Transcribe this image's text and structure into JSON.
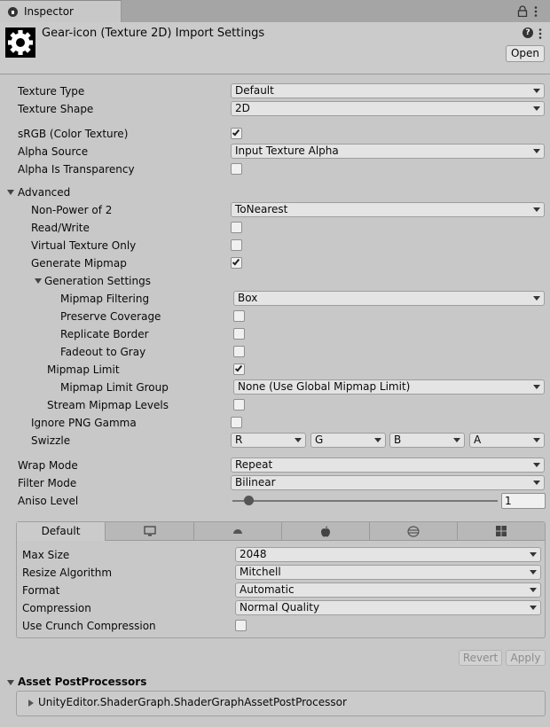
{
  "window": {
    "tab_title": "Inspector"
  },
  "header": {
    "title": "Gear-icon (Texture 2D) Import Settings",
    "open_button": "Open"
  },
  "fields": {
    "texture_type": {
      "label": "Texture Type",
      "value": "Default"
    },
    "texture_shape": {
      "label": "Texture Shape",
      "value": "2D"
    },
    "srgb": {
      "label": "sRGB (Color Texture)",
      "checked": true
    },
    "alpha_source": {
      "label": "Alpha Source",
      "value": "Input Texture Alpha"
    },
    "alpha_is_transparency": {
      "label": "Alpha Is Transparency",
      "checked": false
    },
    "advanced": {
      "label": "Advanced",
      "expanded": true
    },
    "non_power_of_2": {
      "label": "Non-Power of 2",
      "value": "ToNearest"
    },
    "read_write": {
      "label": "Read/Write",
      "checked": false
    },
    "virtual_texture_only": {
      "label": "Virtual Texture Only",
      "checked": false
    },
    "generate_mipmap": {
      "label": "Generate Mipmap",
      "checked": true
    },
    "generation_settings": {
      "label": "Generation Settings",
      "expanded": true
    },
    "mipmap_filtering": {
      "label": "Mipmap Filtering",
      "value": "Box"
    },
    "preserve_coverage": {
      "label": "Preserve Coverage",
      "checked": false
    },
    "replicate_border": {
      "label": "Replicate Border",
      "checked": false
    },
    "fadeout_to_gray": {
      "label": "Fadeout to Gray",
      "checked": false
    },
    "mipmap_limit": {
      "label": "Mipmap Limit",
      "checked": true
    },
    "mipmap_limit_group": {
      "label": "Mipmap Limit Group",
      "value": "None (Use Global Mipmap Limit)"
    },
    "stream_mipmap_levels": {
      "label": "Stream Mipmap Levels",
      "checked": false
    },
    "ignore_png_gamma": {
      "label": "Ignore PNG Gamma",
      "checked": false
    },
    "swizzle": {
      "label": "Swizzle",
      "values": [
        "R",
        "G",
        "B",
        "A"
      ]
    },
    "wrap_mode": {
      "label": "Wrap Mode",
      "value": "Repeat"
    },
    "filter_mode": {
      "label": "Filter Mode",
      "value": "Bilinear"
    },
    "aniso_level": {
      "label": "Aniso Level",
      "value": "1",
      "slider_fraction": 0.06
    }
  },
  "platform": {
    "tabs": [
      {
        "label": "Default",
        "icon": ""
      },
      {
        "label": "",
        "icon": "monitor-icon"
      },
      {
        "label": "",
        "icon": "android-icon"
      },
      {
        "label": "",
        "icon": "apple-icon"
      },
      {
        "label": "",
        "icon": "webgl-icon"
      },
      {
        "label": "",
        "icon": "windows-icon"
      }
    ],
    "max_size": {
      "label": "Max Size",
      "value": "2048"
    },
    "resize_algorithm": {
      "label": "Resize Algorithm",
      "value": "Mitchell"
    },
    "format": {
      "label": "Format",
      "value": "Automatic"
    },
    "compression": {
      "label": "Compression",
      "value": "Normal Quality"
    },
    "use_crunch": {
      "label": "Use Crunch Compression",
      "checked": false
    }
  },
  "actions": {
    "revert": "Revert",
    "apply": "Apply"
  },
  "postprocessors": {
    "label": "Asset PostProcessors",
    "items": [
      "UnityEditor.ShaderGraph.ShaderGraphAssetPostProcessor"
    ]
  }
}
